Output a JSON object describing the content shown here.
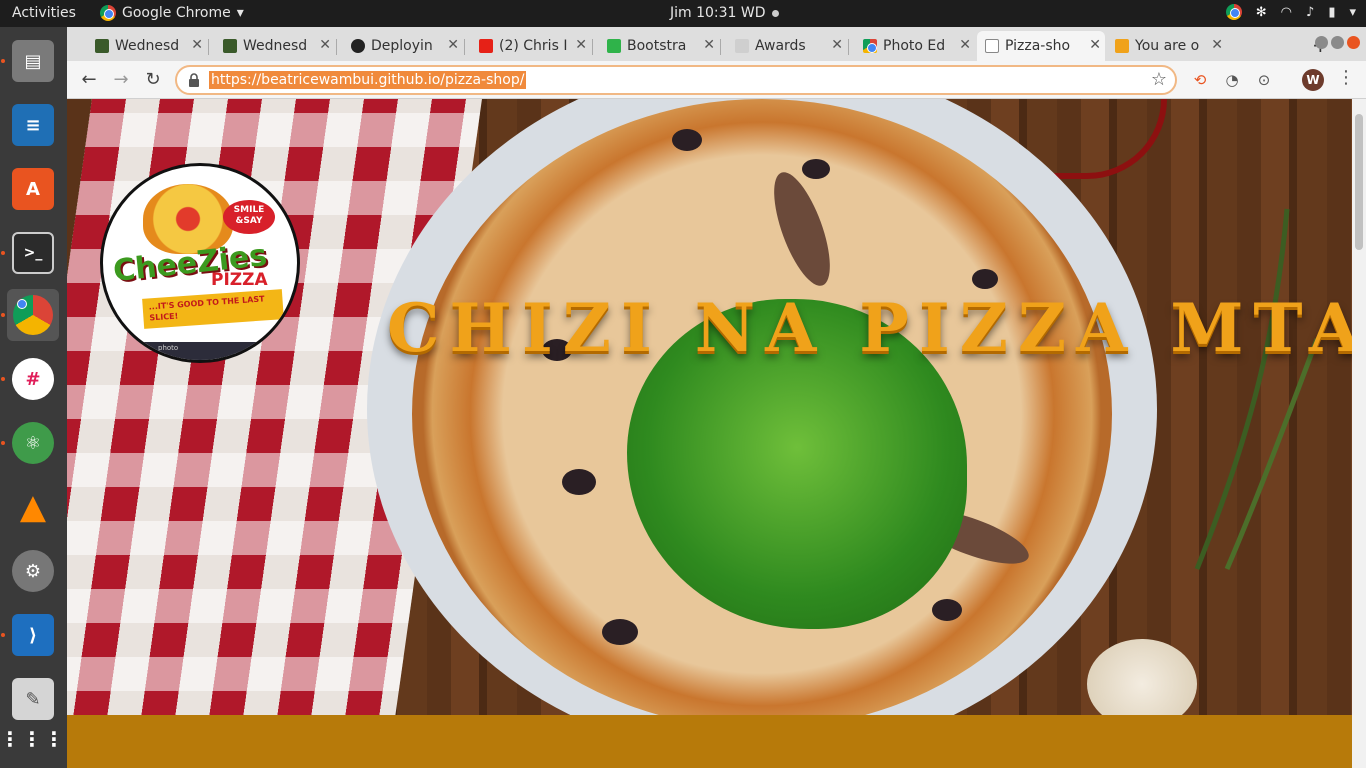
{
  "topbar": {
    "activities": "Activities",
    "app_name": "Google Chrome",
    "clock": "Jim 10:31 WD"
  },
  "tabs": [
    {
      "label": "Wednesd",
      "favicon_color": "#3a5a2a"
    },
    {
      "label": "Wednesd",
      "favicon_color": "#3a5a2a"
    },
    {
      "label": "Deployin",
      "favicon_color": "#222222"
    },
    {
      "label": "(2) Chris I",
      "favicon_color": "#e62117"
    },
    {
      "label": "Bootstra",
      "favicon_color": "#2fb34a"
    },
    {
      "label": "Awards",
      "favicon_color": "#cfcfcf"
    },
    {
      "label": "Photo Ed",
      "favicon_color": "#4285f4"
    },
    {
      "label": "Pizza-sho",
      "favicon_color": "#e0e0e0"
    },
    {
      "label": "You are o",
      "favicon_color": "#f0a21a"
    }
  ],
  "address_bar": {
    "url": "https://beatricewambui.github.io/pizza-shop/"
  },
  "profile_initial": "W",
  "page": {
    "headline": "CHIZI NA PIZZA MTAANI",
    "logo": {
      "smile": "SMILE &SAY",
      "brand": "CheeZies",
      "sub": "PIZZA",
      "tagline": "...IT'S GOOD TO THE LAST SLICE!",
      "footer": "photo"
    },
    "band_color": "#b77a0a",
    "headline_color": "#f0a21a"
  },
  "dock": [
    {
      "name": "files-icon",
      "color": "#6b6b6b"
    },
    {
      "name": "writer-icon",
      "color": "#1f6fb5"
    },
    {
      "name": "software-center-icon",
      "color": "#e95420"
    },
    {
      "name": "terminal-icon",
      "color": "#2b2b2b"
    },
    {
      "name": "chrome-icon",
      "color": "#4285f4"
    },
    {
      "name": "slack-icon",
      "color": "#ffffff"
    },
    {
      "name": "atom-icon",
      "color": "#4caf50"
    },
    {
      "name": "vlc-icon",
      "color": "#ff8800"
    },
    {
      "name": "settings-icon",
      "color": "#777777"
    },
    {
      "name": "vscode-icon",
      "color": "#1e6fbf"
    },
    {
      "name": "notes-icon",
      "color": "#cccccc"
    },
    {
      "name": "apps-grid-icon",
      "color": "#ffffff"
    }
  ]
}
